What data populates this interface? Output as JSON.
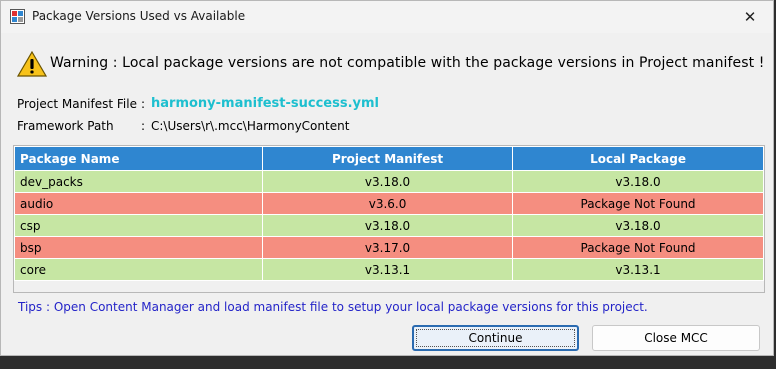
{
  "window": {
    "title": "Package Versions Used vs Available"
  },
  "warning": {
    "text": "Warning : Local package versions are not compatible with the package versions in Project manifest !"
  },
  "info": {
    "manifest_label": "Project Manifest File",
    "manifest_sep": ":",
    "manifest_value": "harmony-manifest-success.yml",
    "framework_label": "Framework Path",
    "framework_sep": ":",
    "framework_value": "C:\\Users\\r\\.mcc\\HarmonyContent"
  },
  "table": {
    "headers": [
      "Package Name",
      "Project Manifest",
      "Local Package"
    ],
    "rows": [
      {
        "name": "dev_packs",
        "manifest": "v3.18.0",
        "local": "v3.18.0",
        "status": "match"
      },
      {
        "name": "audio",
        "manifest": "v3.6.0",
        "local": "Package Not Found",
        "status": "mismatch"
      },
      {
        "name": "csp",
        "manifest": "v3.18.0",
        "local": "v3.18.0",
        "status": "match"
      },
      {
        "name": "bsp",
        "manifest": "v3.17.0",
        "local": "Package Not Found",
        "status": "mismatch"
      },
      {
        "name": "core",
        "manifest": "v3.13.1",
        "local": "v3.13.1",
        "status": "match"
      }
    ]
  },
  "tips": "Tips : Open Content Manager and load manifest file to setup your local package versions for this project.",
  "buttons": {
    "continue": "Continue",
    "close": "Close MCC"
  },
  "colors": {
    "header": "#2f86d0",
    "match_row": "#c6e6a3",
    "mismatch_row": "#f58e80",
    "link": "#1dbfcf",
    "tips": "#2424c8"
  },
  "icons": {
    "app": "app-icon",
    "warning": "warning-triangle-icon",
    "close": "close-icon"
  }
}
